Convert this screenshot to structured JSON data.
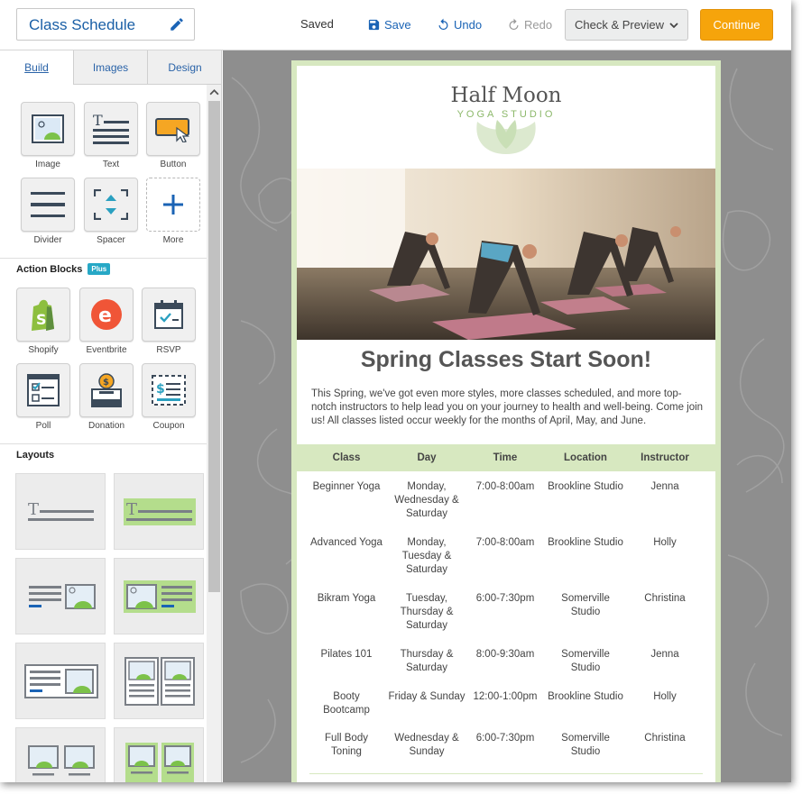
{
  "topbar": {
    "title": "Class Schedule",
    "saved": "Saved",
    "save": "Save",
    "undo": "Undo",
    "redo": "Redo",
    "preview": "Check & Preview",
    "continue": "Continue"
  },
  "colors": {
    "accent": "#1a63b5",
    "continue": "#f6a40b",
    "email_green": "#d7e8c0",
    "plus_badge": "#27a8c6"
  },
  "tabs": [
    "Build",
    "Images",
    "Design"
  ],
  "blocks": [
    {
      "label": "Image",
      "icon": "image-icon"
    },
    {
      "label": "Text",
      "icon": "text-icon"
    },
    {
      "label": "Button",
      "icon": "button-icon"
    },
    {
      "label": "Divider",
      "icon": "divider-icon"
    },
    {
      "label": "Spacer",
      "icon": "spacer-icon"
    },
    {
      "label": "More",
      "icon": "plus-icon"
    }
  ],
  "action_blocks": {
    "title": "Action Blocks",
    "badge": "Plus",
    "items": [
      {
        "label": "Shopify",
        "icon": "shopify-icon"
      },
      {
        "label": "Eventbrite",
        "icon": "eventbrite-icon"
      },
      {
        "label": "RSVP",
        "icon": "calendar-icon"
      },
      {
        "label": "Poll",
        "icon": "poll-icon"
      },
      {
        "label": "Donation",
        "icon": "donation-icon"
      },
      {
        "label": "Coupon",
        "icon": "coupon-icon"
      }
    ]
  },
  "layouts": {
    "title": "Layouts"
  },
  "email": {
    "logo_title": "Half Moon",
    "logo_sub": "YOGA STUDIO",
    "headline": "Spring Classes Start Soon!",
    "intro": "This Spring, we've got even more styles, more classes scheduled, and more top-notch instructors to help lead you on your journey to health and well-being. Come join us! All classes listed occur weekly for the months of April, May, and June.",
    "table": {
      "headers": [
        "Class",
        "Day",
        "Time",
        "Location",
        "Instructor"
      ],
      "rows": [
        {
          "class": "Beginner Yoga",
          "day": "Monday, Wednesday & Saturday",
          "time": "7:00-8:00am",
          "location": "Brookline Studio",
          "instructor": "Jenna"
        },
        {
          "class": "Advanced Yoga",
          "day": "Monday, Tuesday & Saturday",
          "time": "7:00-8:00am",
          "location": "Brookline Studio",
          "instructor": "Holly"
        },
        {
          "class": "Bikram Yoga",
          "day": "Tuesday, Thursday & Saturday",
          "time": "6:00-7:30pm",
          "location": "Somerville Studio",
          "instructor": "Christina"
        },
        {
          "class": "Pilates 101",
          "day": "Thursday & Saturday",
          "time": "8:00-9:30am",
          "location": "Somerville Studio",
          "instructor": "Jenna"
        },
        {
          "class": "Booty Bootcamp",
          "day": "Friday & Sunday",
          "time": "12:00-1:00pm",
          "location": "Brookline Studio",
          "instructor": "Holly"
        },
        {
          "class": "Full Body Toning",
          "day": "Wednesday & Sunday",
          "time": "6:00-7:30pm",
          "location": "Somerville Studio",
          "instructor": "Christina"
        }
      ]
    }
  }
}
